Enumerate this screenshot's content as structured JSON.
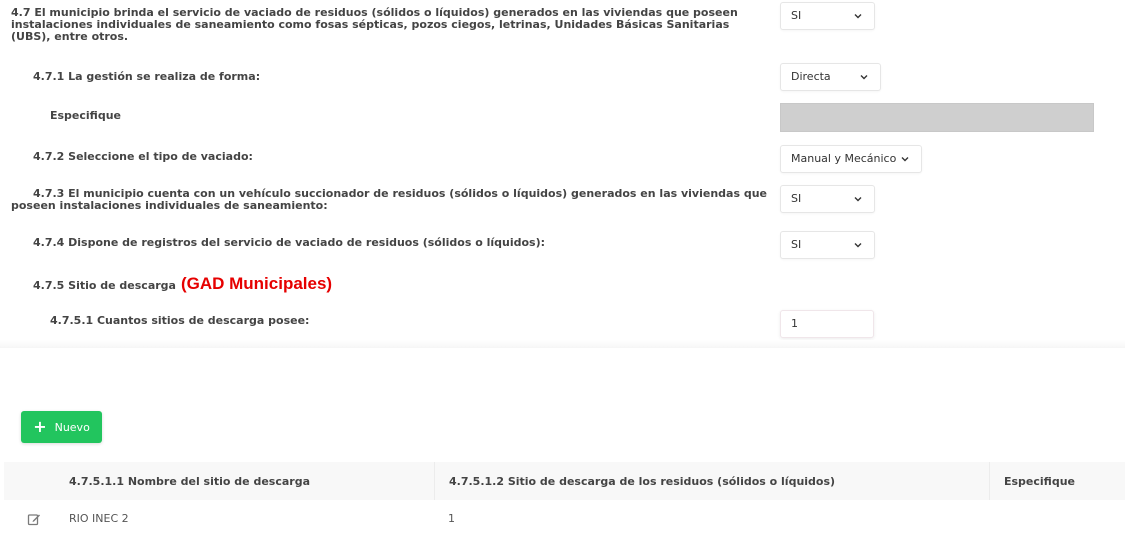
{
  "questions": {
    "q47": {
      "label": "4.7 El municipio brinda el servicio de vaciado de residuos (sólidos o líquidos) generados en las viviendas que poseen instalaciones individuales de saneamiento como fosas sépticas, pozos ciegos, letrinas, Unidades Básicas Sanitarias (UBS), entre otros.",
      "value": "SI"
    },
    "q471": {
      "label": "4.7.1 La gestión se realiza de forma:",
      "value": "Directa"
    },
    "especifique": {
      "label": "Especifique",
      "value": ""
    },
    "q472": {
      "label": "4.7.2 Seleccione el tipo de vaciado:",
      "value": "Manual y Mecánico"
    },
    "q473": {
      "label": "4.7.3 El municipio cuenta con un vehículo succionador de residuos (sólidos o líquidos) generados en las viviendas que poseen instalaciones individuales de saneamiento:",
      "value": "SI"
    },
    "q474": {
      "label": "4.7.4 Dispone de registros del servicio de vaciado de residuos (sólidos o líquidos):",
      "value": "SI"
    },
    "q475": {
      "label": "4.7.5 Sitio de descarga",
      "highlight": "(GAD Municipales)"
    },
    "q4751": {
      "label": "4.7.5.1 Cuantos sitios de descarga posee:",
      "value": "1"
    }
  },
  "toolbar": {
    "new_label": "Nuevo"
  },
  "table": {
    "headers": [
      "4.7.5.1.1 Nombre del sitio de descarga",
      "4.7.5.1.2 Sitio de descarga de los residuos (sólidos o líquidos)",
      "Especifique"
    ],
    "rows": [
      {
        "name": "RIO INEC 2",
        "site": "1",
        "specify": ""
      }
    ]
  },
  "colors": {
    "accent_green": "#22c55e",
    "highlight_red": "#e60000",
    "disabled_gray": "#cfcfcf"
  }
}
